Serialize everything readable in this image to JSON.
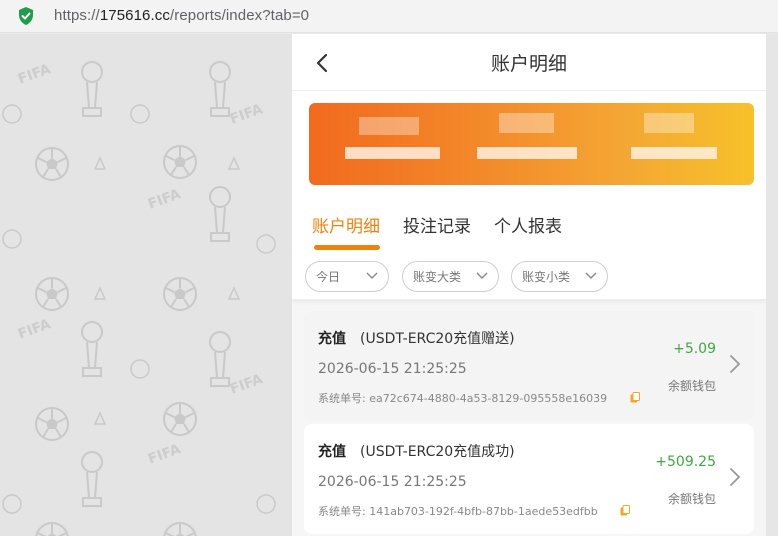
{
  "browser": {
    "url_scheme": "https://",
    "url_host": "175616.cc",
    "url_path": "/reports/index?tab=0"
  },
  "header": {
    "title": "账户明细"
  },
  "tabs": [
    {
      "label": "账户明细",
      "active": true
    },
    {
      "label": "投注记录",
      "active": false
    },
    {
      "label": "个人报表",
      "active": false
    }
  ],
  "filters": [
    {
      "label": "今日"
    },
    {
      "label": "账变大类"
    },
    {
      "label": "账变小类"
    }
  ],
  "records": [
    {
      "type": "充值",
      "desc": "(USDT-ERC20充值赠送)",
      "time": "2026-06-15 21:25:25",
      "order_label": "系统单号:",
      "order_id": "ea72c674-4880-4a53-8129-095558e16039",
      "amount": "+5.09",
      "wallet": "余额钱包"
    },
    {
      "type": "充值",
      "desc": "(USDT-ERC20充值成功)",
      "time": "2026-06-15 21:25:25",
      "order_label": "系统单号:",
      "order_id": "141ab703-192f-4bfb-87bb-1aede53edfbb",
      "amount": "+509.25",
      "wallet": "余额钱包"
    }
  ],
  "colors": {
    "accent": "#f0810a",
    "amount_positive": "#3daa3d",
    "shield": "#1e9e4a"
  }
}
